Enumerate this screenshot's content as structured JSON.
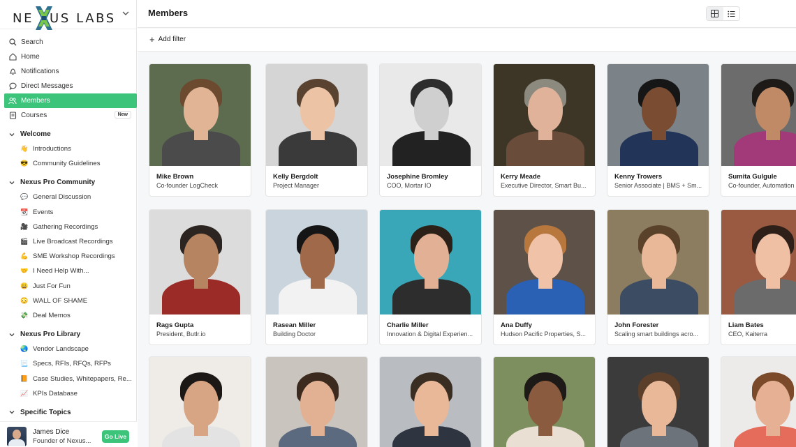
{
  "brand": {
    "name_left": "NE",
    "name_right": "US LABS"
  },
  "nav": [
    {
      "label": "Search",
      "icon": "search-icon"
    },
    {
      "label": "Home",
      "icon": "home-icon"
    },
    {
      "label": "Notifications",
      "icon": "bell-icon"
    },
    {
      "label": "Direct Messages",
      "icon": "chat-bubble-icon"
    },
    {
      "label": "Members",
      "icon": "people-icon",
      "active": true
    },
    {
      "label": "Courses",
      "icon": "book-icon",
      "badge": "New"
    }
  ],
  "sections": [
    {
      "title": "Welcome",
      "items": [
        {
          "emoji": "👋",
          "label": "Introductions"
        },
        {
          "emoji": "😎",
          "label": "Community Guidelines"
        }
      ]
    },
    {
      "title": "Nexus Pro Community",
      "items": [
        {
          "emoji": "💬",
          "label": "General Discussion"
        },
        {
          "emoji": "📆",
          "label": "Events"
        },
        {
          "emoji": "🎥",
          "label": "Gathering Recordings"
        },
        {
          "emoji": "🎬",
          "label": "Live Broadcast Recordings"
        },
        {
          "emoji": "💪",
          "label": "SME Workshop Recordings"
        },
        {
          "emoji": "🤝",
          "label": "I Need Help With..."
        },
        {
          "emoji": "😀",
          "label": "Just For Fun"
        },
        {
          "emoji": "😳",
          "label": "WALL OF SHAME"
        },
        {
          "emoji": "💸",
          "label": "Deal Memos"
        }
      ]
    },
    {
      "title": "Nexus Pro Library",
      "items": [
        {
          "emoji": "🌏",
          "label": "Vendor Landscape"
        },
        {
          "emoji": "📃",
          "label": "Specs, RFIs, RFQs, RFPs"
        },
        {
          "emoji": "📙",
          "label": "Case Studies, Whitepapers, Re..."
        },
        {
          "emoji": "📈",
          "label": "KPIs Database"
        }
      ]
    },
    {
      "title": "Specific Topics",
      "items": []
    }
  ],
  "user": {
    "name": "James Dice",
    "role": "Founder of Nexus...",
    "go_live": "Go Live"
  },
  "header": {
    "title": "Members",
    "add_filter": "Add filter"
  },
  "members": [
    {
      "name": "Mike Brown",
      "title": "Co-founder LogCheck"
    },
    {
      "name": "Kelly Bergdolt",
      "title": "Project Manager"
    },
    {
      "name": "Josephine Bromley",
      "title": "COO, Mortar IO"
    },
    {
      "name": "Kerry Meade",
      "title": "Executive Director, Smart Bu..."
    },
    {
      "name": "Kenny Trowers",
      "title": "Senior Associate | BMS + Sm..."
    },
    {
      "name": "Sumita Gulgule",
      "title": "Co-founder, Automation"
    },
    {
      "name": "Rags Gupta",
      "title": "President, Butlr.io"
    },
    {
      "name": "Rasean Miller",
      "title": "Building Doctor"
    },
    {
      "name": "Charlie Miller",
      "title": "Innovation & Digital Experien..."
    },
    {
      "name": "Ana Duffy",
      "title": "Hudson Pacific Properties, S..."
    },
    {
      "name": "John Forester",
      "title": "Scaling smart buildings acro..."
    },
    {
      "name": "Liam Bates",
      "title": "CEO, Kaiterra"
    },
    {
      "name": "",
      "title": ""
    },
    {
      "name": "",
      "title": ""
    },
    {
      "name": "",
      "title": ""
    },
    {
      "name": "",
      "title": ""
    },
    {
      "name": "",
      "title": ""
    },
    {
      "name": "",
      "title": ""
    }
  ]
}
